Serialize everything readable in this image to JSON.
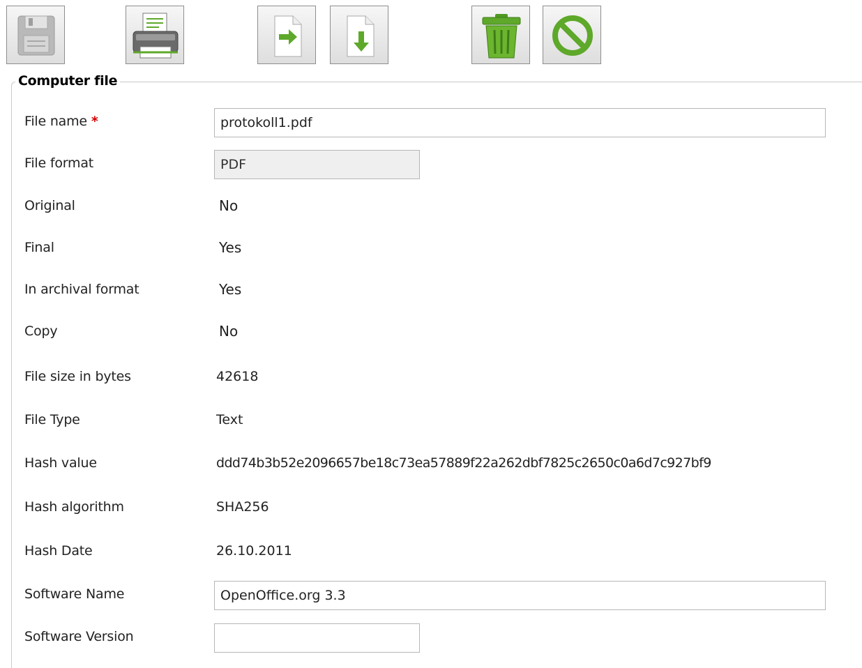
{
  "toolbar": {
    "buttons": [
      {
        "name": "save",
        "icon": "floppy-disk-icon"
      },
      {
        "name": "print",
        "icon": "printer-icon"
      },
      {
        "name": "next",
        "icon": "arrow-right-icon"
      },
      {
        "name": "download",
        "icon": "arrow-down-icon"
      },
      {
        "name": "delete",
        "icon": "trash-icon"
      },
      {
        "name": "cancel",
        "icon": "no-entry-icon"
      }
    ],
    "colors": {
      "accent_green": "#5ea82a",
      "icon_gray": "#b5b5b5"
    }
  },
  "section": {
    "title": "Computer file"
  },
  "fields": {
    "file_name": {
      "label": "File name",
      "required_marker": "*",
      "value": "protokoll1.pdf"
    },
    "file_format": {
      "label": "File format",
      "value": "PDF"
    },
    "original": {
      "label": "Original",
      "value": "No"
    },
    "final": {
      "label": "Final",
      "value": "Yes"
    },
    "archival_format": {
      "label": "In archival format",
      "value": "Yes"
    },
    "copy": {
      "label": "Copy",
      "value": "No"
    },
    "file_size": {
      "label": "File size in bytes",
      "value": "42618"
    },
    "file_type": {
      "label": "File Type",
      "value": "Text"
    },
    "hash_value": {
      "label": "Hash value",
      "value": "ddd74b3b52e2096657be18c73ea57889f22a262dbf7825c2650c0a6d7c927bf9"
    },
    "hash_algorithm": {
      "label": "Hash algorithm",
      "value": "SHA256"
    },
    "hash_date": {
      "label": "Hash Date",
      "value": "26.10.2011"
    },
    "software_name": {
      "label": "Software Name",
      "value": "OpenOffice.org 3.3"
    },
    "software_version": {
      "label": "Software Version",
      "value": ""
    }
  }
}
